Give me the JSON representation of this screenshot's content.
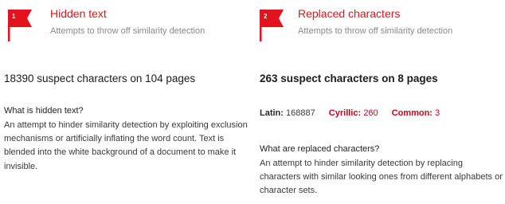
{
  "hidden_text": {
    "flag_number": "1",
    "title": "Hidden text",
    "subtitle": "Attempts to throw off similarity detection",
    "summary": "18390 suspect characters on 104 pages",
    "question": "What is hidden text?",
    "description": "An attempt to hinder similarity detection by exploiting exclusion mechanisms or artificially inflating the word count. Text is blended into the white background of a document to make it invisible.",
    "flag_color": "#e2131c"
  },
  "replaced_characters": {
    "flag_number": "2",
    "title": "Replaced characters",
    "subtitle": "Attempts to throw off similarity detection",
    "summary": "263 suspect characters on 8 pages",
    "scripts": {
      "latin_label": "Latin:",
      "latin_value": "168887",
      "cyrillic_label": "Cyrillic:",
      "cyrillic_value": "260",
      "common_label": "Common:",
      "common_value": "3"
    },
    "question": "What are replaced characters?",
    "description": "An attempt to hinder similarity detection by replacing characters with similar looking ones from different alphabets or character sets.",
    "flag_color": "#e2131c"
  }
}
